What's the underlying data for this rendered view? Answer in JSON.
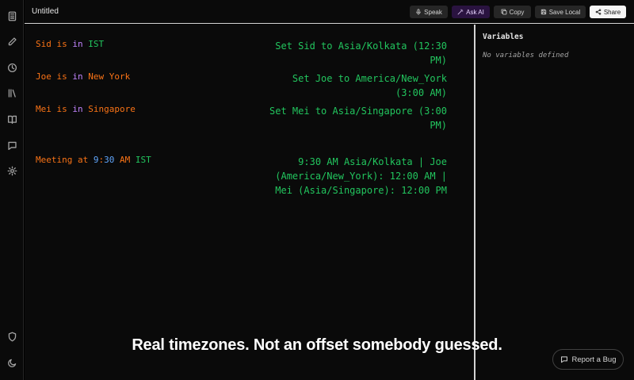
{
  "header": {
    "title": "Untitled",
    "buttons": {
      "speak": "Speak",
      "ask_ai": "Ask AI",
      "copy": "Copy",
      "save_local": "Save Local",
      "share": "Share"
    }
  },
  "sidebar": {
    "icons": [
      "calculator-icon",
      "pencil-icon",
      "clock-icon",
      "library-icon",
      "book-icon",
      "chat-icon",
      "gear-icon",
      "shield-icon",
      "moon-icon"
    ]
  },
  "editor": {
    "lines": [
      {
        "name": "Sid",
        "is": "is",
        "in": "in",
        "zone": "IST"
      },
      {
        "name": "Joe",
        "is": "is",
        "in": "in",
        "zone": "New York"
      },
      {
        "name": "Mei",
        "is": "is",
        "in": "in",
        "zone": "Singapore"
      }
    ],
    "meeting": {
      "word": "Meeting",
      "at": "at",
      "hour": "9",
      "colon": ":",
      "minute": "30",
      "ampm": "AM",
      "zone": "IST"
    },
    "results": [
      "Set Sid to Asia/Kolkata (12:30 PM)",
      "Set Joe to America/New_York (3:00 AM)",
      "Set Mei to Asia/Singapore (3:00 PM)",
      "9:30 AM Asia/Kolkata | Joe (America/New_York): 12:00 AM | Mei (Asia/Singapore): 12:00 PM"
    ]
  },
  "variables_panel": {
    "title": "Variables",
    "empty": "No variables defined"
  },
  "caption": "Real timezones. Not an offset somebody guessed.",
  "report_bug": "Report a Bug"
}
